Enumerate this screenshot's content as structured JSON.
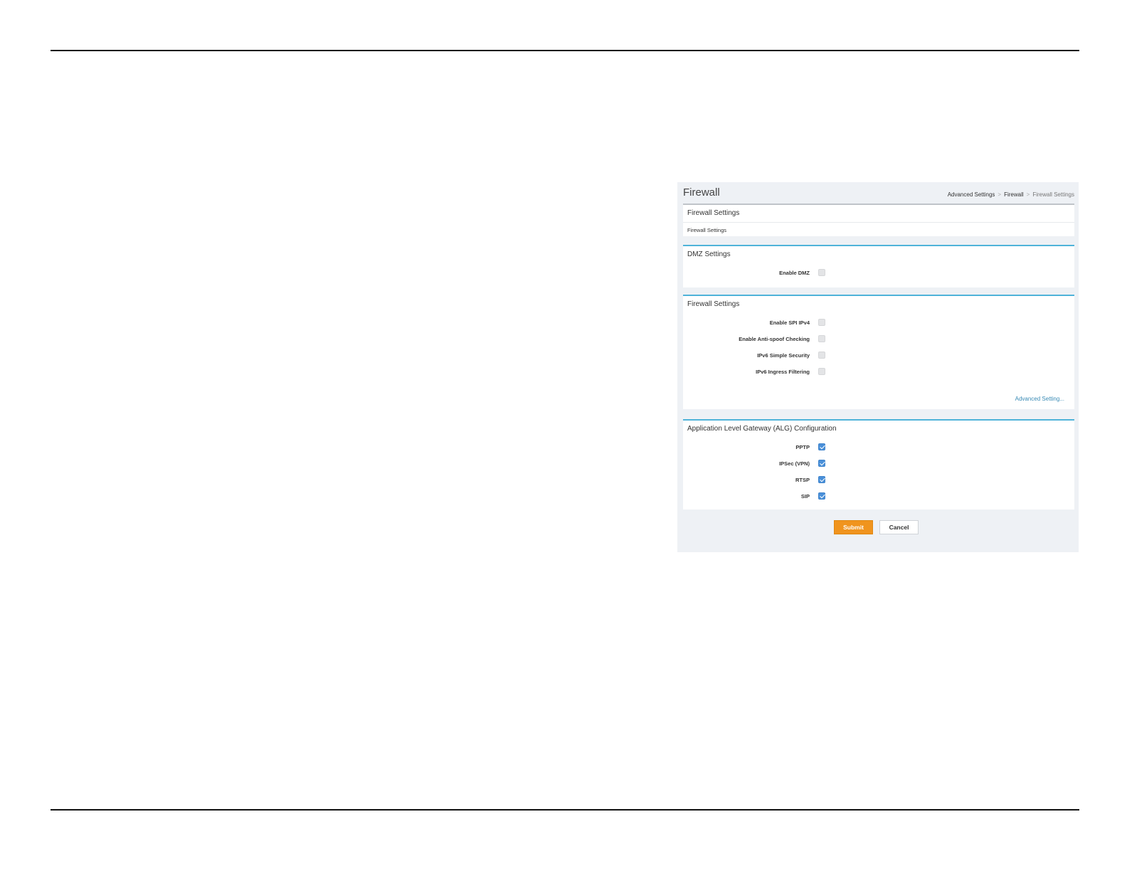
{
  "header": {
    "title": "Firewall",
    "breadcrumb": [
      "Advanced Settings",
      "Firewall",
      "Firewall Settings"
    ],
    "separator": ">"
  },
  "sections": {
    "top": {
      "title": "Firewall Settings",
      "subtitle": "Firewall Settings"
    },
    "dmz": {
      "title": "DMZ Settings",
      "rows": [
        {
          "label": "Enable DMZ",
          "checked": false
        }
      ]
    },
    "firewall": {
      "title": "Firewall Settings",
      "rows": [
        {
          "label": "Enable SPI IPv4",
          "checked": false
        },
        {
          "label": "Enable Anti-spoof Checking",
          "checked": false
        },
        {
          "label": "IPv6 Simple Security",
          "checked": false
        },
        {
          "label": "IPv6 Ingress Filtering",
          "checked": false
        }
      ],
      "advanced_link": "Advanced Setting..."
    },
    "alg": {
      "title": "Application Level Gateway (ALG) Configuration",
      "rows": [
        {
          "label": "PPTP",
          "checked": true
        },
        {
          "label": "IPSec (VPN)",
          "checked": true
        },
        {
          "label": "RTSP",
          "checked": true
        },
        {
          "label": "SIP",
          "checked": true
        }
      ]
    }
  },
  "actions": {
    "submit_label": "Submit",
    "cancel_label": "Cancel"
  },
  "colors": {
    "accent": "#4fb3d9",
    "submit": "#f0941e",
    "checkbox_on": "#4a90d9"
  }
}
